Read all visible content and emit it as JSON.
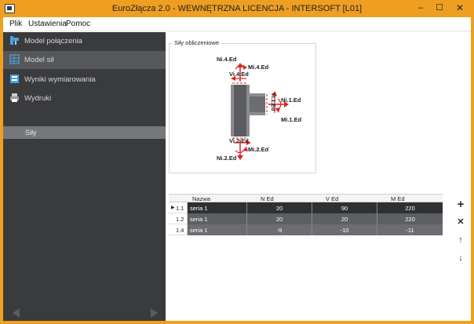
{
  "window": {
    "title": "EuroZłącza 2.0 - WEWNĘTRZNA LICENCJA - INTERSOFT [L01]",
    "minimize": "–",
    "maximize": "☐",
    "close": "✕"
  },
  "menu": {
    "items": [
      "Plik",
      "Ustawienia",
      "Pomoc"
    ]
  },
  "sidebar": {
    "items": [
      {
        "label": "Model połączenia",
        "icon": "connection-model-icon"
      },
      {
        "label": "Model sił",
        "icon": "force-model-icon"
      },
      {
        "label": "Wyniki wymiarowania",
        "icon": "results-icon"
      },
      {
        "label": "Wydruki",
        "icon": "printer-icon"
      }
    ],
    "active_index": 1,
    "subitem": "Siły"
  },
  "diagram": {
    "group_title": "Siły obliczeniowe",
    "labels": {
      "n4": "Ni.4.Ed",
      "m4": "Mi.4.Ed",
      "v4": "Vi.4.Ed",
      "v1": "Vi.1.Ed",
      "n1": "Ni.1.Ed",
      "m1": "Mi.1.Ed",
      "v2": "Vi.2.Ed",
      "m2": "Mi.2.Ed",
      "n2": "Ni.2.Ed"
    },
    "accent_color": "#e02020"
  },
  "table": {
    "headers": {
      "name": "Nazwa",
      "n": "N Ed",
      "v": "V Ed",
      "m": "M Ed"
    },
    "rows": [
      {
        "id": "1.1",
        "name": "seria 1",
        "n": "20",
        "v": "90",
        "m": "220"
      },
      {
        "id": "1.2",
        "name": "seria 1",
        "n": "20",
        "v": "20",
        "m": "220"
      },
      {
        "id": "1.4",
        "name": "seria 1",
        "n": "-9",
        "v": "-10",
        "m": "-11"
      }
    ],
    "selected_row": 0
  },
  "toolbar": {
    "add": "+",
    "remove": "✕",
    "move_up": "↑",
    "move_down": "↓"
  },
  "colors": {
    "title_bar": "#ee9f22",
    "sidebar": "#3a3b3d",
    "selected_row": "#2f3033"
  }
}
